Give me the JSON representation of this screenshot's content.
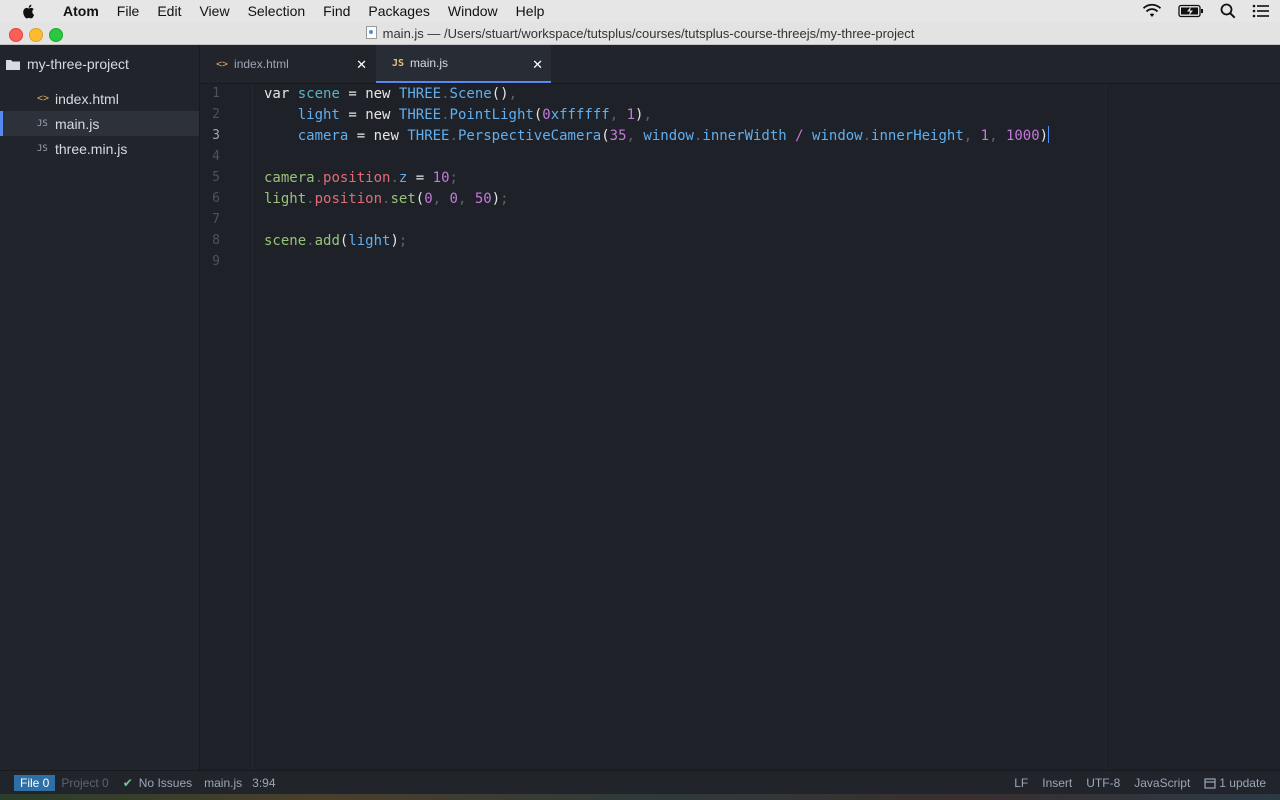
{
  "menubar": {
    "app_name": "Atom",
    "items": [
      "File",
      "Edit",
      "View",
      "Selection",
      "Find",
      "Packages",
      "Window",
      "Help"
    ],
    "status_icons": [
      "wifi-icon",
      "battery-icon",
      "spotlight-icon",
      "notification-center-icon"
    ]
  },
  "window": {
    "title": "main.js — /Users/stuart/workspace/tutsplus/courses/tutsplus-course-threejs/my-three-project"
  },
  "treeview": {
    "project": "my-three-project",
    "files": [
      {
        "name": "index.html",
        "icon": "html-file-icon",
        "glyph": "<>",
        "selected": false
      },
      {
        "name": "main.js",
        "icon": "js-file-icon",
        "glyph": "JS",
        "selected": true
      },
      {
        "name": "three.min.js",
        "icon": "js-file-icon",
        "glyph": "JS",
        "selected": false
      }
    ]
  },
  "tabs": [
    {
      "title": "index.html",
      "glyph": "<>",
      "active": false
    },
    {
      "title": "main.js",
      "glyph": "JS",
      "active": true
    }
  ],
  "editor": {
    "line_numbers": [
      "1",
      "2",
      "3",
      "4",
      "5",
      "6",
      "7",
      "8",
      "9"
    ],
    "current_line": 3,
    "lines": [
      "var scene = new THREE.Scene(),",
      "    light = new THREE.PointLight(0xffffff, 1),",
      "    camera = new THREE.PerspectiveCamera(35, window.innerWidth / window.innerHeight, 1, 1000)",
      "",
      "camera.position.z = 10;",
      "light.position.set(0, 0, 50);",
      "",
      "scene.add(light);",
      ""
    ],
    "selected_text": "0xffffff"
  },
  "statusbar": {
    "file_label": "File 0",
    "project_label": "Project 0",
    "issues": "No Issues",
    "filename": "main.js",
    "cursor_pos": "3:94",
    "line_ending": "LF",
    "mode": "Insert",
    "encoding": "UTF-8",
    "grammar": "JavaScript",
    "updates": "1 update"
  },
  "colors": {
    "accent": "#568af2",
    "close_red": "#fc5f57",
    "minimize_yellow": "#fdbc2e",
    "maximize_green": "#28c840"
  }
}
